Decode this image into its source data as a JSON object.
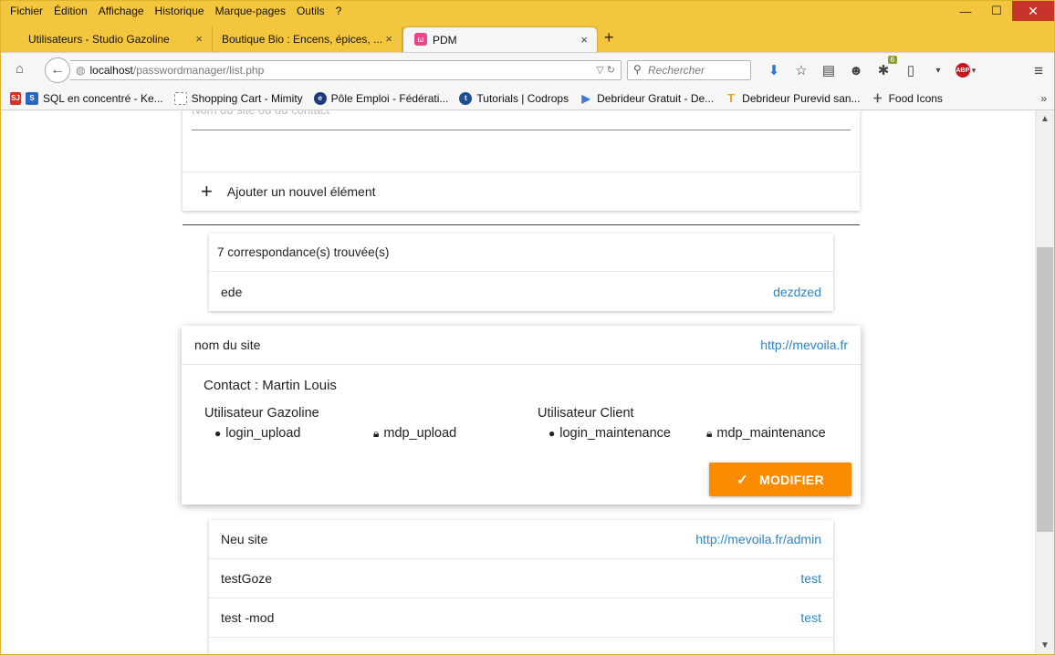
{
  "menu": [
    "Fichier",
    "Édition",
    "Affichage",
    "Historique",
    "Marque-pages",
    "Outils",
    "?"
  ],
  "window_controls": {
    "minimize": "—",
    "maximize": "☐",
    "close": "✕"
  },
  "tabs": [
    {
      "label": "Utilisateurs - Studio Gazoline",
      "active": false
    },
    {
      "label": "Boutique Bio : Encens, épices, ...",
      "active": false
    },
    {
      "label": "PDM",
      "active": true
    }
  ],
  "tab_close": "×",
  "new_tab": "+",
  "nav": {
    "url_host": "localhost",
    "url_path": "/passwordmanager/list.php",
    "search_placeholder": "Rechercher",
    "badge_count": "6",
    "abp": "ABP"
  },
  "bookmarks": [
    {
      "label": "SQL en concentré - Ke...",
      "color": "#2c67c4",
      "glyph": "S"
    },
    {
      "label": "Shopping Cart - Mimity",
      "color": "#ffffff",
      "glyph": ""
    },
    {
      "label": "Pôle Emploi - Fédérati...",
      "color": "#1d3c7a",
      "glyph": "e"
    },
    {
      "label": "Tutorials | Codrops",
      "color": "#1d4f91",
      "glyph": "t"
    },
    {
      "label": "Debrideur Gratuit - De...",
      "color": "#3a7bd5",
      "glyph": "▶"
    },
    {
      "label": "Debrideur Purevid san...",
      "color": "#f0b020",
      "glyph": "T"
    },
    {
      "label": "Food Icons",
      "color": "#555555",
      "glyph": "ⵜ"
    }
  ],
  "bookmarks_more": "»",
  "search_form": {
    "placeholder": "Nom du site ou du contact",
    "add_label": "Ajouter un nouvel élément",
    "add_glyph": "+"
  },
  "results": {
    "count_label": "7 correspondance(s) trouvée(s)",
    "first": {
      "name": "ede",
      "link": "dezdzed"
    }
  },
  "detail": {
    "site": "nom du site",
    "url": "http://mevoila.fr",
    "contact": "Contact : Martin Louis",
    "gazoline": {
      "title": "Utilisateur Gazoline",
      "login": "login_upload",
      "password": "mdp_upload"
    },
    "client": {
      "title": "Utilisateur Client",
      "login": "login_maintenance",
      "password": "mdp_maintenance"
    },
    "modify_label": "MODIFIER"
  },
  "more_results": [
    {
      "name": "Neu site",
      "link": "http://mevoila.fr/admin"
    },
    {
      "name": "testGoze",
      "link": "test"
    },
    {
      "name": "test -mod",
      "link": "test"
    }
  ],
  "colors": {
    "accent_orange": "#fb8c00",
    "link_blue": "#2a86c8",
    "chrome_yellow": "#f3c63d"
  }
}
